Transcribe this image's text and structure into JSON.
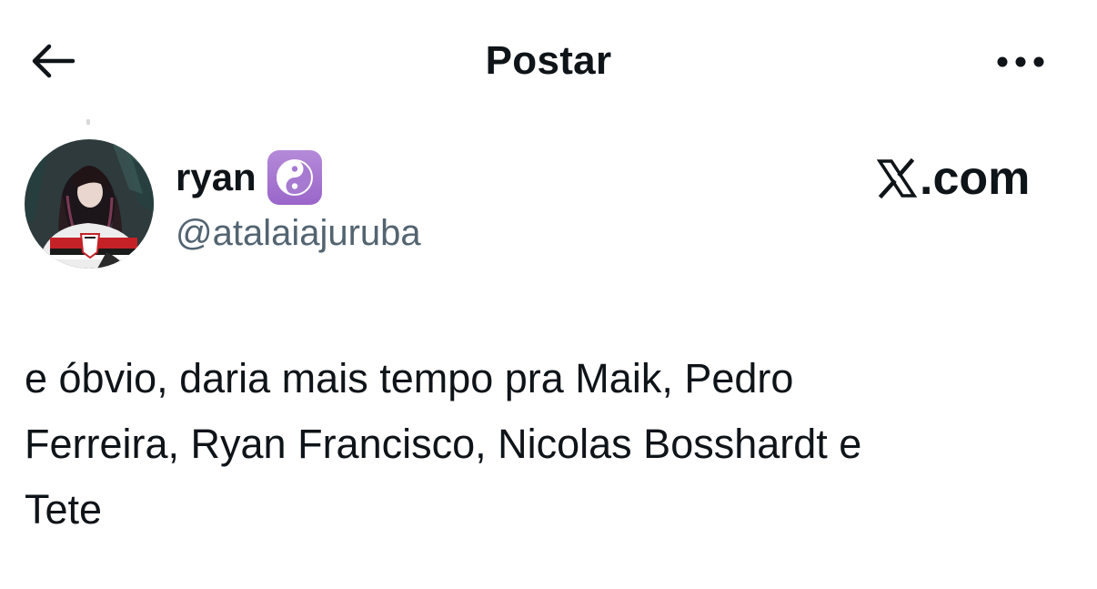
{
  "header": {
    "title": "Postar",
    "back_icon": "arrow-left-icon",
    "more_icon": "more-horizontal-icon"
  },
  "author": {
    "display_name": "ryan",
    "badge_icon": "yin-yang-icon",
    "badge_color": "#a77ad2",
    "handle": "@atalaiajuruba"
  },
  "brand": {
    "label": ".com",
    "icon": "x-logo-icon"
  },
  "post": {
    "text": "e óbvio, daria mais tempo pra Maik, Pedro\nFerreira, Ryan Francisco, Nicolas Bosshardt e\nTete"
  },
  "colors": {
    "text": "#0f1419",
    "secondary_text": "#536471",
    "background": "#ffffff"
  }
}
